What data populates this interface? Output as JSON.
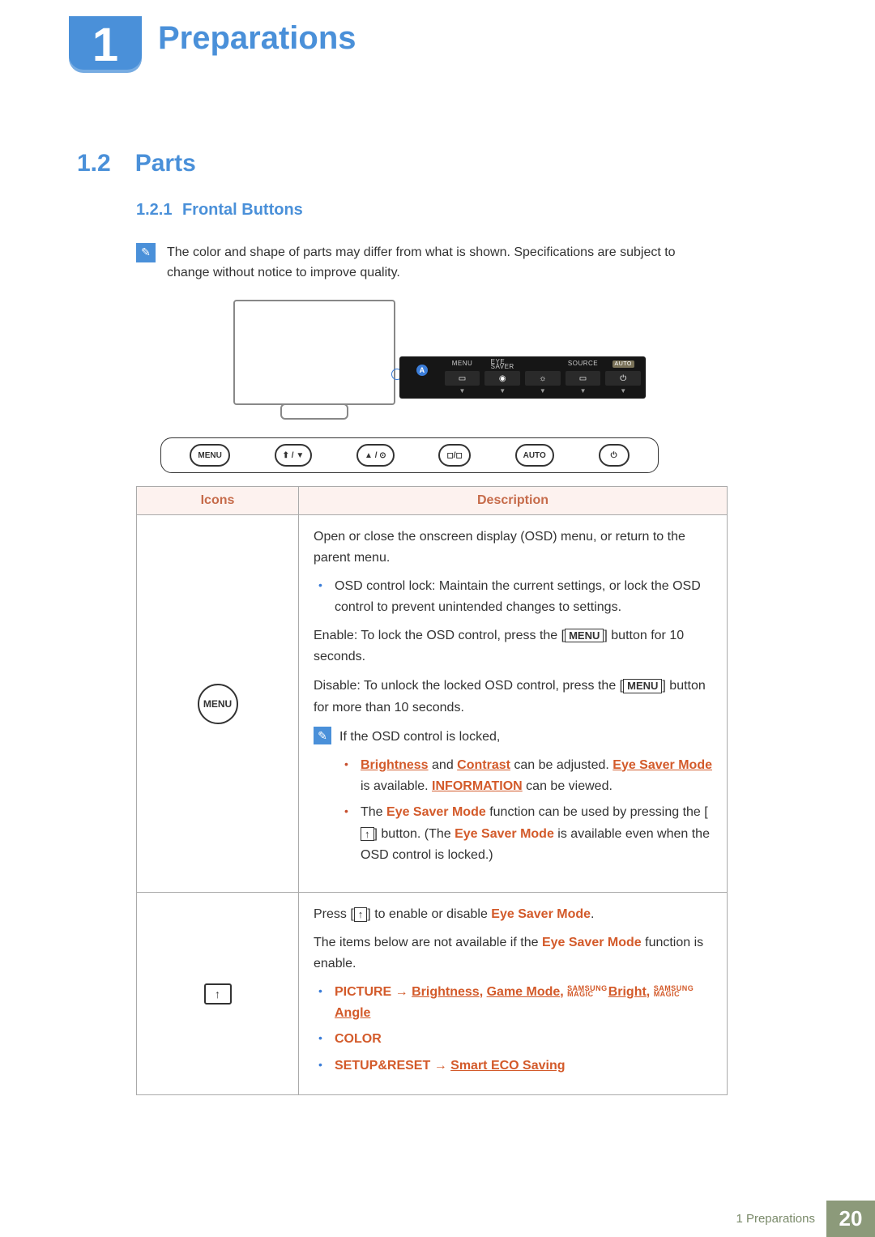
{
  "chapter": {
    "number": "1",
    "title": "Preparations"
  },
  "section": {
    "number": "1.2",
    "title": "Parts"
  },
  "subsection": {
    "number": "1.2.1",
    "title": "Frontal Buttons"
  },
  "note": "The color and shape of parts may differ from what is shown. Specifications are subject to change without notice to improve quality.",
  "zoom_labels": {
    "a": "A",
    "menu": "MENU",
    "eye_saver_top": "EYE",
    "eye_saver_bottom": "SAVER",
    "source": "SOURCE",
    "auto": "AUTO"
  },
  "button_bar": {
    "menu": "MENU",
    "nav1": "⬆ / ▼",
    "nav2": "▲ / ⊙",
    "source": "◻/◻",
    "auto": "AUTO",
    "power": "⏻"
  },
  "table": {
    "head_icons": "Icons",
    "head_desc": "Description",
    "row1": {
      "icon_label": "MENU",
      "p1": "Open or close the onscreen display (OSD) menu, or return to the parent menu.",
      "b1": "OSD control lock: Maintain the current settings, or lock the OSD control to prevent unintended changes to settings.",
      "p2a": "Enable: To lock the OSD control, press the [",
      "p2b": "] button for 10 seconds.",
      "p3a": "Disable: To unlock the locked OSD control, press the [",
      "p3b": "] button for more than 10 seconds.",
      "menu_ibox": "MENU",
      "note_lead": "If the OSD control is locked,",
      "nb1_a": "Brightness",
      "nb1_b": " and ",
      "nb1_c": "Contrast",
      "nb1_d": " can be adjusted. ",
      "nb1_e": "Eye Saver Mode",
      "nb1_f": " is available. ",
      "nb1_g": "INFORMATION",
      "nb1_h": " can be viewed.",
      "nb2_a": "The ",
      "nb2_b": "Eye Saver Mode",
      "nb2_c": " function can be used by pressing the [",
      "nb2_d": "] button. (The ",
      "nb2_e": "Eye Saver Mode",
      "nb2_f": " is available even when the OSD control is locked.)",
      "arrow_ibox": "↑"
    },
    "row2": {
      "icon_glyph": "↑",
      "p1a": "Press [",
      "p1b": "] to enable or disable ",
      "p1c": "Eye Saver Mode",
      "p1d": ".",
      "p2a": "The items below are not available if the ",
      "p2b": "Eye Saver Mode",
      "p2c": " function is enable.",
      "b1_a": "PICTURE",
      "b1_arrow": " → ",
      "b1_b": "Brightness",
      "b1_c": ", ",
      "b1_d": "Game Mode",
      "b1_e": ", ",
      "b1_magic1_top": "SAMSUNG",
      "b1_magic1_bot": "MAGIC",
      "b1_f": "Bright",
      "b1_g": ", ",
      "b1_magic2_top": "SAMSUNG",
      "b1_magic2_bot": "MAGIC",
      "b1_h": "Angle",
      "b2": "COLOR",
      "b3_a": "SETUP&RESET",
      "b3_arrow": " → ",
      "b3_b": "Smart ECO Saving"
    }
  },
  "footer": {
    "chapter_ref": "1 Preparations",
    "page": "20"
  }
}
